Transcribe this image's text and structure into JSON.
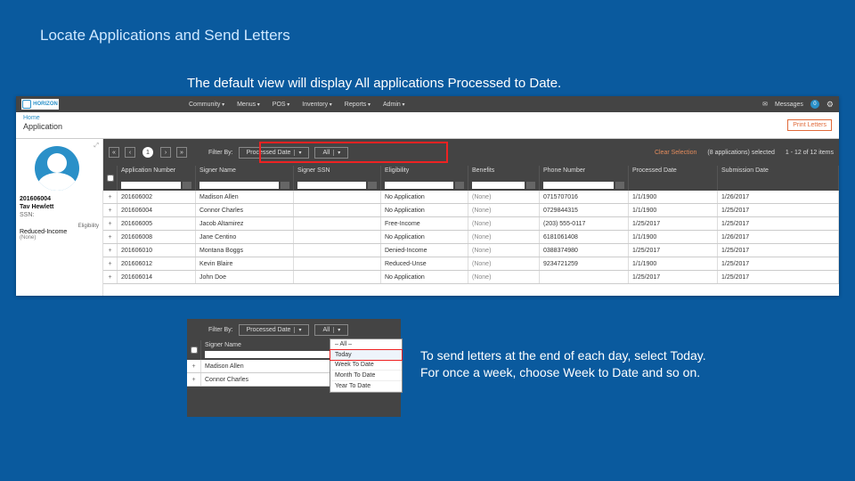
{
  "title": "Locate Applications and Send Letters",
  "subtitle": "The default view will display All applications Processed to Date.",
  "caption2": "To send letters at the end of each day, select Today. For once a week, choose Week to Date and so on.",
  "topbar": {
    "logo": "HORIZON",
    "menu": [
      "Community",
      "Menus",
      "POS",
      "Inventory",
      "Reports",
      "Admin"
    ],
    "messages_label": "Messages",
    "messages_count": "0"
  },
  "header": {
    "breadcrumb": "Home",
    "page": "Application",
    "print_button": "Print Letters"
  },
  "sidebar": {
    "id": "201606004",
    "name": "Tav Hewlett",
    "ssn_label": "SSN:",
    "eligibility_label": "Eligibility",
    "eligibility_value": "Reduced-Income",
    "none": "(None)"
  },
  "toolbar": {
    "page": "1",
    "filter_by_label": "Filter By:",
    "filter_field": "Processed Date",
    "filter_range": "All",
    "clear": "Clear Selection",
    "selected": "(8 applications) selected",
    "paging": "1 - 12 of 12 items"
  },
  "columns": [
    "Application Number",
    "Signer Name",
    "Signer SSN",
    "Eligibility",
    "Benefits",
    "Phone Number",
    "Processed Date",
    "Submission Date"
  ],
  "rows": [
    {
      "num": "201606002",
      "name": "Madison Allen",
      "elig": "No Application",
      "ben": "(None)",
      "phone": "0715707016",
      "pd": "1/1/1900",
      "sd": "1/26/2017"
    },
    {
      "num": "201606004",
      "name": "Connor Charles",
      "elig": "No Application",
      "ben": "(None)",
      "phone": "0729844315",
      "pd": "1/1/1900",
      "sd": "1/25/2017"
    },
    {
      "num": "201606005",
      "name": "Jacob Altamirez",
      "elig": "Free-Income",
      "ben": "(None)",
      "phone": "(203) 555-0117",
      "pd": "1/25/2017",
      "sd": "1/25/2017"
    },
    {
      "num": "201606008",
      "name": "Jane Centino",
      "elig": "No Application",
      "ben": "(None)",
      "phone": "6181061408",
      "pd": "1/1/1900",
      "sd": "1/26/2017"
    },
    {
      "num": "201606010",
      "name": "Montana Boggs",
      "elig": "Denied-Income",
      "ben": "(None)",
      "phone": "0388374980",
      "pd": "1/25/2017",
      "sd": "1/25/2017"
    },
    {
      "num": "201606012",
      "name": "Kevin Blaire",
      "elig": "Reduced-Unse",
      "ben": "(None)",
      "phone": "9234721259",
      "pd": "1/1/1900",
      "sd": "1/25/2017"
    },
    {
      "num": "201606014",
      "name": "John Doe",
      "elig": "No Application",
      "ben": "(None)",
      "phone": "",
      "pd": "1/25/2017",
      "sd": "1/25/2017"
    }
  ],
  "dropdown": {
    "options": [
      "– All –",
      "Today",
      "Week To Date",
      "Month To Date",
      "Year To Date"
    ],
    "selected_index": 1
  },
  "shot2": {
    "filter_by_label": "Filter By:",
    "filter_field": "Processed Date",
    "filter_range": "All",
    "col_name": "Signer Name",
    "row1": "Madison Allen",
    "row2": "Connor Charles"
  }
}
